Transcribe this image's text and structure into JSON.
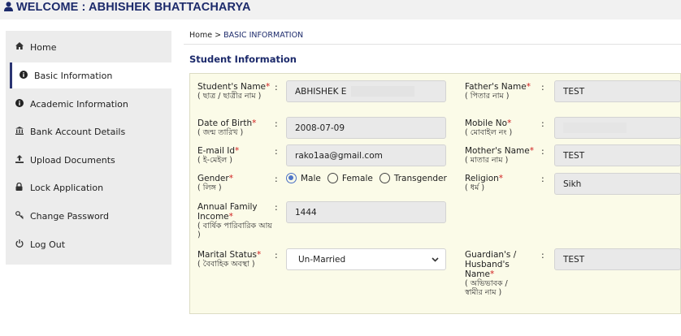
{
  "header": {
    "title": "WELCOME : ABHISHEK BHATTACHARYA",
    "user_icon": "user-icon"
  },
  "sidebar": {
    "items": [
      {
        "label": "Home",
        "icon": "home-icon",
        "glyph": "⌂"
      },
      {
        "label": "Basic Information",
        "icon": "info-icon",
        "glyph": "ℹ"
      },
      {
        "label": "Academic Information",
        "icon": "info-icon",
        "glyph": "ℹ"
      },
      {
        "label": "Bank Account Details",
        "icon": "bank-icon",
        "glyph": "⌂"
      },
      {
        "label": "Upload Documents",
        "icon": "upload-icon",
        "glyph": "⤒"
      },
      {
        "label": "Lock Application",
        "icon": "lock-icon",
        "glyph": "🔒"
      },
      {
        "label": "Change Password",
        "icon": "key-icon",
        "glyph": "⚿"
      },
      {
        "label": "Log Out",
        "icon": "power-icon",
        "glyph": "⏻"
      }
    ],
    "active_index": 1
  },
  "breadcrumb": {
    "home": "Home",
    "separator": " > ",
    "current": "BASIC INFORMATION"
  },
  "section_title": "Student Information",
  "form": {
    "student_name": {
      "label": "Student's Name",
      "req": "*",
      "sub": "( ছাত্র / ছাত্রীর নাম )",
      "value": "ABHISHEK  E"
    },
    "dob": {
      "label": "Date of Birth",
      "req": "*",
      "sub": "( জন্ম তারিখ )",
      "value": "2008-07-09"
    },
    "email": {
      "label": "E-mail Id",
      "req": "*",
      "sub": "( ই-মেইল )",
      "value": "rako1aa@gmail.com"
    },
    "gender": {
      "label": "Gender",
      "req": "*",
      "sub": "( লিঙ্গ )",
      "options": [
        "Male",
        "Female",
        "Transgender"
      ],
      "selected": "Male"
    },
    "income": {
      "label": "Annual Family Income",
      "req": "*",
      "sub": "( বার্ষিক পারিবারিক আয় )",
      "value": "1444"
    },
    "marital": {
      "label": "Marital Status",
      "req": "*",
      "sub": "( বৈবাহিক অবস্থা )",
      "value": "Un-Married"
    },
    "father": {
      "label": "Father's Name",
      "req": "*",
      "sub": "( পিতার নাম )",
      "value": "TEST"
    },
    "mobile": {
      "label": "Mobile No",
      "req": "*",
      "sub": "( মোবাইল নং )",
      "value": ""
    },
    "mother": {
      "label": "Mother's Name",
      "req": "*",
      "sub": "( মাতার নাম )",
      "value": "TEST"
    },
    "religion": {
      "label": "Religion",
      "req": "*",
      "sub": "( ধর্ম )",
      "value": "Sikh"
    },
    "guardian": {
      "label": "Guardian's / Husband's Name",
      "req": "*",
      "sub": "( অভিভাবক / স্বামীর নাম )",
      "value": "TEST"
    }
  },
  "colon": ":"
}
